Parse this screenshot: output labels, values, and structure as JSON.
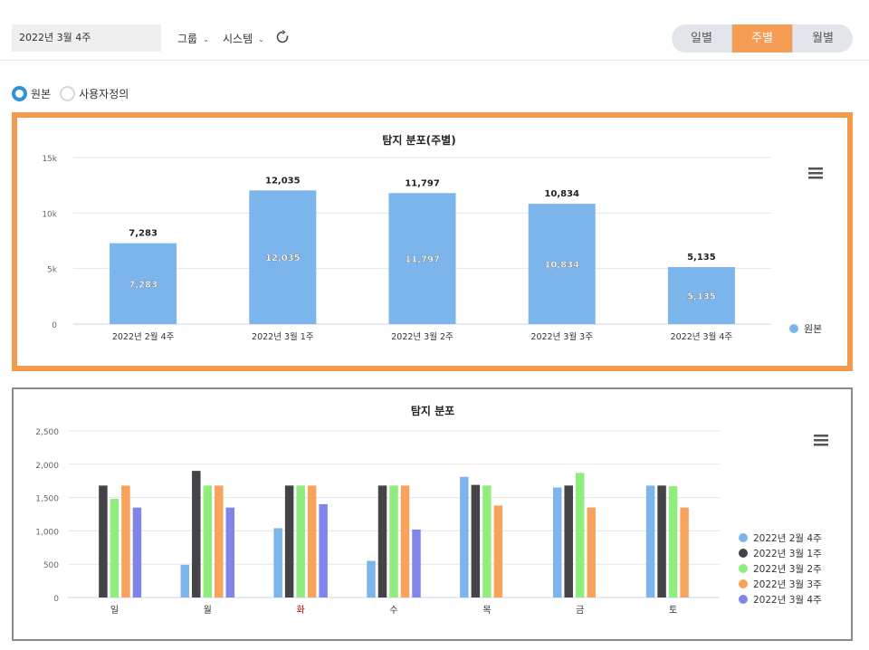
{
  "toolbar": {
    "date_value": "2022년 3월 4주",
    "group_label": "그룹",
    "system_label": "시스템",
    "period_tabs": [
      {
        "label": "일별",
        "active": false
      },
      {
        "label": "주별",
        "active": true
      },
      {
        "label": "월별",
        "active": false
      }
    ],
    "icons": {
      "chevron": "chevron-down-icon",
      "refresh": "refresh-icon"
    }
  },
  "mode_options": [
    {
      "label": "원본",
      "selected": true
    },
    {
      "label": "사용자정의",
      "selected": false
    }
  ],
  "colors": {
    "accent": "#f59d55",
    "radio_selected": "#2f93d6",
    "bar_blue": "#7cb5ec",
    "series": [
      "#7cb5ec",
      "#434348",
      "#90ed7d",
      "#f7a35c",
      "#8085e9"
    ],
    "weekday_highlight": "#cc0000"
  },
  "chart_data": [
    {
      "type": "bar",
      "title": "탐지 분포(주별)",
      "categories": [
        "2022년 2월 4주",
        "2022년 3월 1주",
        "2022년 3월 2주",
        "2022년 3월 3주",
        "2022년 3월 4주"
      ],
      "series": [
        {
          "name": "원본",
          "values": [
            7283,
            12035,
            11797,
            10834,
            5135
          ]
        }
      ],
      "data_labels": [
        "7,283",
        "12,035",
        "11,797",
        "10,834",
        "5,135"
      ],
      "y_ticks": [
        "0",
        "5k",
        "10k",
        "15k"
      ],
      "ylim": [
        0,
        15000
      ],
      "grid": true,
      "legend": "right",
      "menu_icon": "hamburger-menu-icon"
    },
    {
      "type": "bar",
      "title": "탐지 분포",
      "categories": [
        "일",
        "월",
        "화",
        "수",
        "목",
        "금",
        "토"
      ],
      "highlight_category": "화",
      "series": [
        {
          "name": "2022년 2월 4주",
          "values": [
            null,
            490,
            1040,
            550,
            1810,
            1650,
            1680
          ]
        },
        {
          "name": "2022년 3월 1주",
          "values": [
            1680,
            1900,
            1680,
            1680,
            1690,
            1680,
            1680
          ]
        },
        {
          "name": "2022년 3월 2주",
          "values": [
            1480,
            1680,
            1680,
            1680,
            1680,
            1870,
            1670
          ]
        },
        {
          "name": "2022년 3월 3주",
          "values": [
            1680,
            1680,
            1680,
            1680,
            1380,
            1350,
            1350
          ]
        },
        {
          "name": "2022년 3월 4주",
          "values": [
            1350,
            1350,
            1400,
            1020,
            null,
            null,
            null
          ]
        }
      ],
      "y_ticks": [
        "0",
        "500",
        "1,000",
        "1,500",
        "2,000",
        "2,500"
      ],
      "ylim": [
        0,
        2500
      ],
      "grid": true,
      "legend": "right",
      "menu_icon": "hamburger-menu-icon"
    }
  ]
}
